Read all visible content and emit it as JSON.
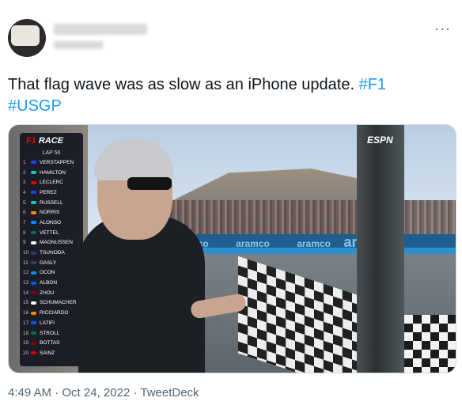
{
  "tweet": {
    "text_plain": "That flag wave was as slow as an iPhone update. ",
    "hashtag_1": "#F1",
    "hashtag_2": "#USGP",
    "more_label": "···"
  },
  "media": {
    "broadcaster": "ESPN",
    "sponsor": "aramco",
    "sponsor_large": "aram",
    "leaderboard": {
      "header": "RACE",
      "lap": "LAP 56",
      "drivers": [
        {
          "pos": "1",
          "name": "VERSTAPPEN",
          "color": "#1e41ff"
        },
        {
          "pos": "2",
          "name": "HAMILTON",
          "color": "#00d2be"
        },
        {
          "pos": "3",
          "name": "LECLERC",
          "color": "#dc0000"
        },
        {
          "pos": "4",
          "name": "PEREZ",
          "color": "#1e41ff"
        },
        {
          "pos": "5",
          "name": "RUSSELL",
          "color": "#00d2be"
        },
        {
          "pos": "6",
          "name": "NORRIS",
          "color": "#ff8700"
        },
        {
          "pos": "7",
          "name": "ALONSO",
          "color": "#0090ff"
        },
        {
          "pos": "8",
          "name": "VETTEL",
          "color": "#006f62"
        },
        {
          "pos": "9",
          "name": "MAGNUSSEN",
          "color": "#ffffff"
        },
        {
          "pos": "10",
          "name": "TSUNODA",
          "color": "#2b4562"
        },
        {
          "pos": "11",
          "name": "GASLY",
          "color": "#2b4562"
        },
        {
          "pos": "12",
          "name": "OCON",
          "color": "#0090ff"
        },
        {
          "pos": "13",
          "name": "ALBON",
          "color": "#005aff"
        },
        {
          "pos": "14",
          "name": "ZHOU",
          "color": "#900000"
        },
        {
          "pos": "15",
          "name": "SCHUMACHER",
          "color": "#ffffff"
        },
        {
          "pos": "16",
          "name": "RICCIARDO",
          "color": "#ff8700"
        },
        {
          "pos": "17",
          "name": "LATIFI",
          "color": "#005aff"
        },
        {
          "pos": "18",
          "name": "STROLL",
          "color": "#006f62"
        },
        {
          "pos": "19",
          "name": "BOTTAS",
          "color": "#900000"
        },
        {
          "pos": "20",
          "name": "SAINZ",
          "color": "#dc0000"
        }
      ]
    }
  },
  "footer": {
    "time": "4:49 AM",
    "separator": " · ",
    "date": "Oct 24, 2022",
    "source": "TweetDeck"
  },
  "colors": {
    "link": "#1d9bf0",
    "text": "#0f1419",
    "muted": "#536471"
  }
}
